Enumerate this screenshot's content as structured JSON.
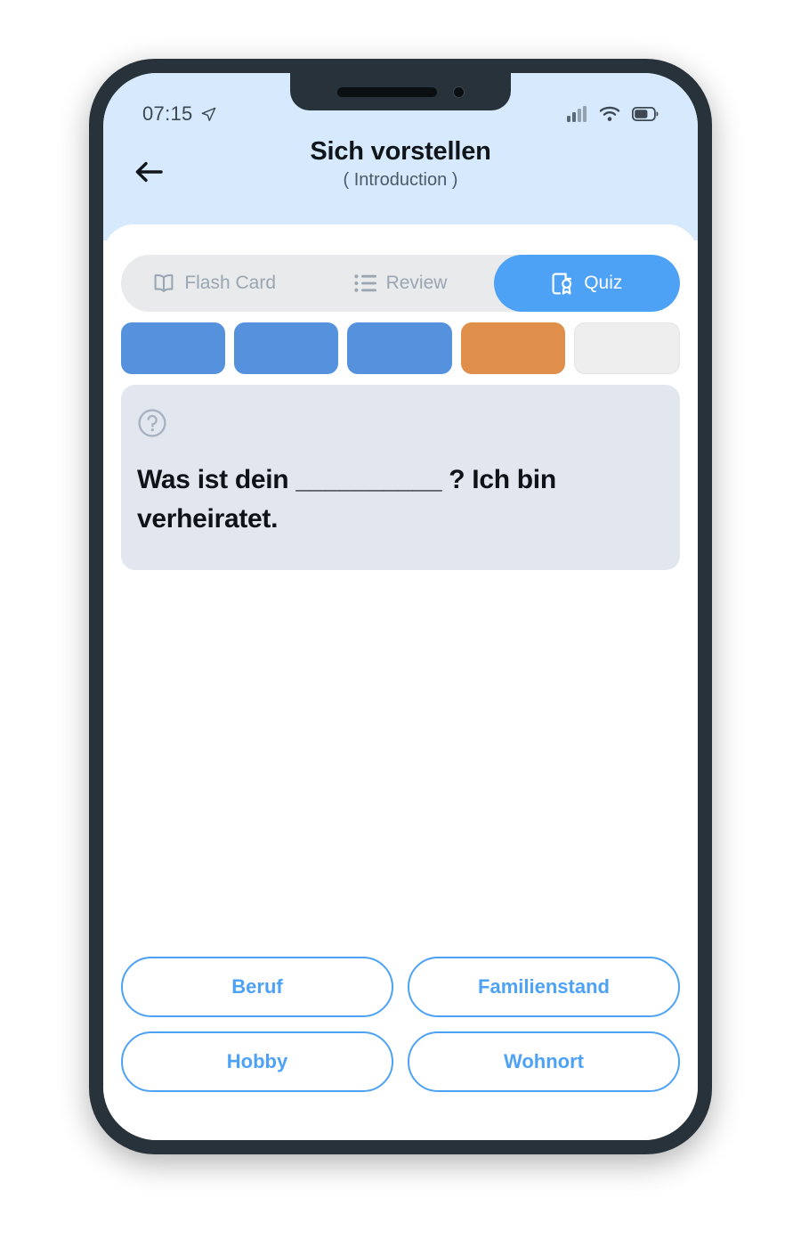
{
  "status_bar": {
    "time": "07:15",
    "location_icon": "location-arrow-icon",
    "signal_icon": "cellular-signal-icon",
    "wifi_icon": "wifi-icon",
    "battery_icon": "battery-icon"
  },
  "header": {
    "back_icon": "back-arrow-icon",
    "title": "Sich vorstellen",
    "subtitle": "( Introduction )"
  },
  "tabs": [
    {
      "label": "Flash Card",
      "icon": "open-book-icon",
      "active": false
    },
    {
      "label": "Review",
      "icon": "bullet-list-icon",
      "active": false
    },
    {
      "label": "Quiz",
      "icon": "quiz-badge-icon",
      "active": true
    }
  ],
  "progress": {
    "total": 5,
    "completed": 3,
    "current_index": 4,
    "states": [
      "done",
      "done",
      "done",
      "current",
      "todo"
    ],
    "colors": {
      "done": "#5591dd",
      "current": "#df8f4a",
      "todo": "#eeeeee"
    }
  },
  "question_card": {
    "icon": "question-mark-circle-icon",
    "text": "Was ist dein __________ ? Ich bin verheiratet."
  },
  "options": [
    {
      "label": "Beruf"
    },
    {
      "label": "Familienstand"
    },
    {
      "label": "Hobby"
    },
    {
      "label": "Wohnort"
    }
  ],
  "theme": {
    "accent": "#4da2f5",
    "header_bg": "#d6e9fd",
    "card_bg": "#e2e6ef",
    "frame": "#27323a"
  }
}
